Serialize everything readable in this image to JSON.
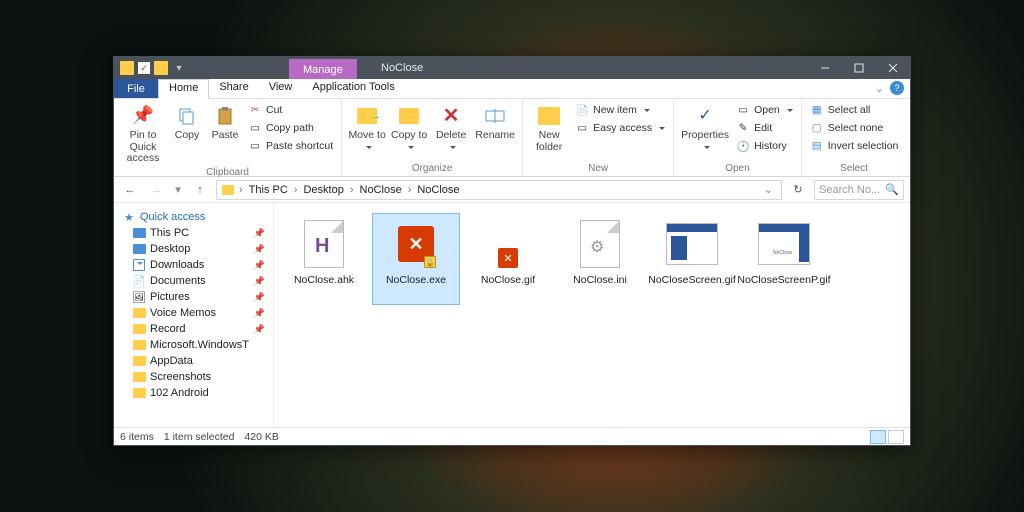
{
  "title_bar": {
    "manage": "Manage",
    "title": "NoClose"
  },
  "menu": {
    "file": "File",
    "home": "Home",
    "share": "Share",
    "view": "View",
    "app_tools": "Application Tools"
  },
  "ribbon": {
    "clipboard": {
      "label": "Clipboard",
      "pin": "Pin to Quick access",
      "copy": "Copy",
      "paste": "Paste",
      "cut": "Cut",
      "copy_path": "Copy path",
      "paste_shortcut": "Paste shortcut"
    },
    "organize": {
      "label": "Organize",
      "move": "Move to",
      "copy": "Copy to",
      "delete": "Delete",
      "rename": "Rename"
    },
    "new_grp": {
      "label": "New",
      "folder": "New folder",
      "item": "New item",
      "easy": "Easy access"
    },
    "open_grp": {
      "label": "Open",
      "properties": "Properties",
      "open": "Open",
      "edit": "Edit",
      "history": "History"
    },
    "select_grp": {
      "label": "Select",
      "all": "Select all",
      "none": "Select none",
      "invert": "Invert selection"
    }
  },
  "breadcrumb": {
    "c0": "This PC",
    "c1": "Desktop",
    "c2": "NoClose",
    "c3": "NoClose"
  },
  "search": {
    "placeholder": "Search No..."
  },
  "nav": {
    "quick": "Quick access",
    "thispc": "This PC",
    "desktop": "Desktop",
    "downloads": "Downloads",
    "documents": "Documents",
    "pictures": "Pictures",
    "voice": "Voice Memos",
    "record": "Record",
    "mswin": "Microsoft.WindowsT",
    "appdata": "AppData",
    "screenshots": "Screenshots",
    "android": "102 Android"
  },
  "files": {
    "f0": "NoClose.ahk",
    "f1": "NoClose.exe",
    "f2": "NoClose.gif",
    "f3": "NoClose.ini",
    "f4": "NoCloseScreen.gif",
    "f5": "NoCloseScreenP.gif"
  },
  "status": {
    "items": "6 items",
    "selected": "1 item selected",
    "size": "420 KB"
  }
}
